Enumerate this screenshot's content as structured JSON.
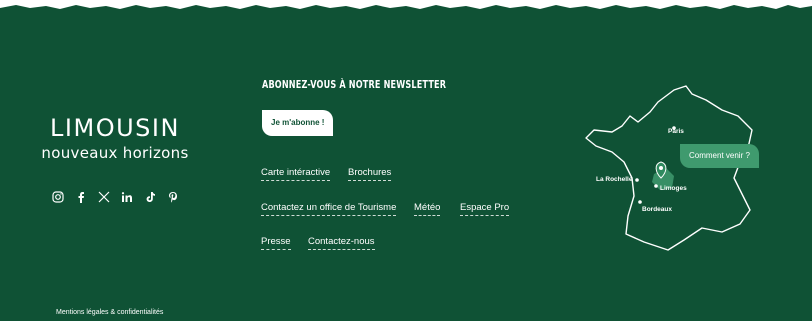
{
  "brand": {
    "name": "LIMOUSIN",
    "tagline": "nouveaux horizons"
  },
  "social": [
    "instagram-icon",
    "facebook-icon",
    "x-icon",
    "linkedin-icon",
    "tiktok-icon",
    "pinterest-icon"
  ],
  "newsletter": {
    "title": "ABONNEZ-VOUS À NOTRE NEWSLETTER",
    "button": "Je m'abonne !"
  },
  "links": {
    "carte": "Carte intéractive",
    "brochures": "Brochures",
    "office": "Contactez un office de Tourisme",
    "meteo": "Météo",
    "espace_pro": "Espace Pro",
    "presse": "Presse",
    "contact": "Contactez-nous"
  },
  "map": {
    "cta": "Comment venir ?",
    "cities": {
      "paris": "Paris",
      "la_rochelle": "La Rochelle",
      "limoges": "Limoges",
      "bordeaux": "Bordeaux"
    }
  },
  "legal": "Mentions légales & confidentialités",
  "colors": {
    "background": "#0f5235",
    "accent": "#3f9a6e",
    "text": "#ffffff"
  }
}
